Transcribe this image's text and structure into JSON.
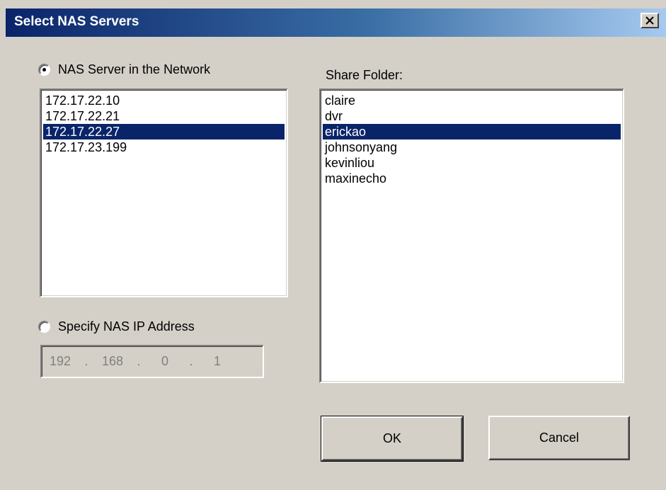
{
  "window": {
    "title": "Select NAS Servers",
    "close_icon": "close-icon"
  },
  "network_option": {
    "label": "NAS Server in the Network",
    "selected": true
  },
  "servers": {
    "items": [
      "172.17.22.10",
      "172.17.22.21",
      "172.17.22.27",
      "172.17.23.199"
    ],
    "selected_index": 2
  },
  "specify_option": {
    "label": "Specify NAS IP Address",
    "selected": false
  },
  "ip_address": {
    "octets": [
      "192",
      "168",
      "0",
      "1"
    ],
    "separator": "."
  },
  "share_folder": {
    "label": "Share Folder:",
    "items": [
      "claire",
      "dvr",
      "erickao",
      "johnsonyang",
      "kevinliou",
      "maxinecho"
    ],
    "selected_index": 2
  },
  "buttons": {
    "ok_label": "OK",
    "cancel_label": "Cancel"
  },
  "colors": {
    "title_bar_start": "#0a246a",
    "title_bar_end": "#a6caf0",
    "selection": "#0a246a",
    "dialog_bg": "#d4d0c8"
  }
}
